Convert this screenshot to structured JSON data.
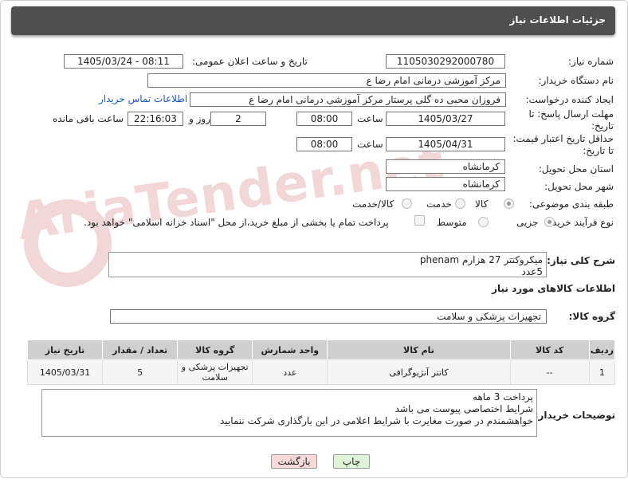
{
  "title": "جزئیات اطلاعات نیاز",
  "watermark": "AriaTender.net",
  "fields": {
    "need_number_label": "شماره نیاز:",
    "need_number": "1105030292000780",
    "announce_label": "تاریخ و ساعت اعلان عمومی:",
    "announce_value": "1405/03/24 - 08:11",
    "buyer_org_label": "نام دستگاه خریدار:",
    "buyer_org": "مرکز آموزشی  درمانی امام رضا  ع",
    "creator_label": "ایجاد کننده درخواست:",
    "creator": "فروزان محبی ده گلی پرستار مرکز آموزشی  درمانی امام رضا  ع",
    "contact_link": "اطلاعات تماس خریدار",
    "deadline_label_1": "مهلت ارسال پاسخ: تا",
    "deadline_label_2": "تاریخ:",
    "deadline_date": "1405/03/27",
    "time_label": "ساعت",
    "deadline_time": "08:00",
    "days_value": "2",
    "days_label": "روز و",
    "remaining_time": "22:16:03",
    "remaining_label": "ساعت باقی مانده",
    "min_price_label_1": "حداقل تاریخ اعتبار قیمت:",
    "min_price_label_2": "تا تاریخ:",
    "min_price_date": "1405/04/31",
    "min_price_time": "08:00",
    "province_label": "استان محل تحویل:",
    "province": "کرمانشاه",
    "city_label": "شهر محل تحویل:",
    "city": "کرمانشاه",
    "category_label": "طبقه بندی موضوعی:",
    "category_options": [
      "کالا",
      "خدمت",
      "کالا/خدمت"
    ],
    "process_label": "نوع فرآیند خرید :",
    "process_options": [
      "جزیی",
      "متوسط"
    ],
    "payment_note": "پرداخت تمام یا بخشی از مبلغ خرید،از محل \"اسناد خزانه اسلامی\" خواهد بود.",
    "general_desc_label": "شرح کلی نیاز:",
    "general_desc": "میکروکتتر 27 هزارم phenam\n5عدد",
    "goods_info_label": "اطلاعات کالاهای مورد نیاز",
    "goods_group_label": "گروه کالا:",
    "goods_group": "تجهیزات پزشکی و سلامت"
  },
  "table": {
    "headers": [
      "ردیف",
      "کد کالا",
      "نام کالا",
      "واحد شمارش",
      "گروه کالا",
      "تعداد / مقدار",
      "تاریخ نیاز"
    ],
    "rows": [
      [
        "1",
        "--",
        "کاتتر آنژیوگرافی",
        "عدد",
        "تجهیزات پزشکی و سلامت",
        "5",
        "1405/03/31"
      ]
    ]
  },
  "buyer_notes_label": "توضیحات خریدار:",
  "buyer_notes": "پرداخت 3 ماهه\nشرایط اختصاصی پیوست می باشد\nخواهشمندم  در صورت مغایرت با شرایط اعلامی در این بارگذاری شرکت ننمایید",
  "buttons": {
    "print": "چاپ",
    "back": "بازگشت"
  },
  "colors": {
    "header": "#4f4f4f",
    "link": "#1a55c8",
    "back_button": "#f8d9d9",
    "print_button": "#dff3d8"
  }
}
